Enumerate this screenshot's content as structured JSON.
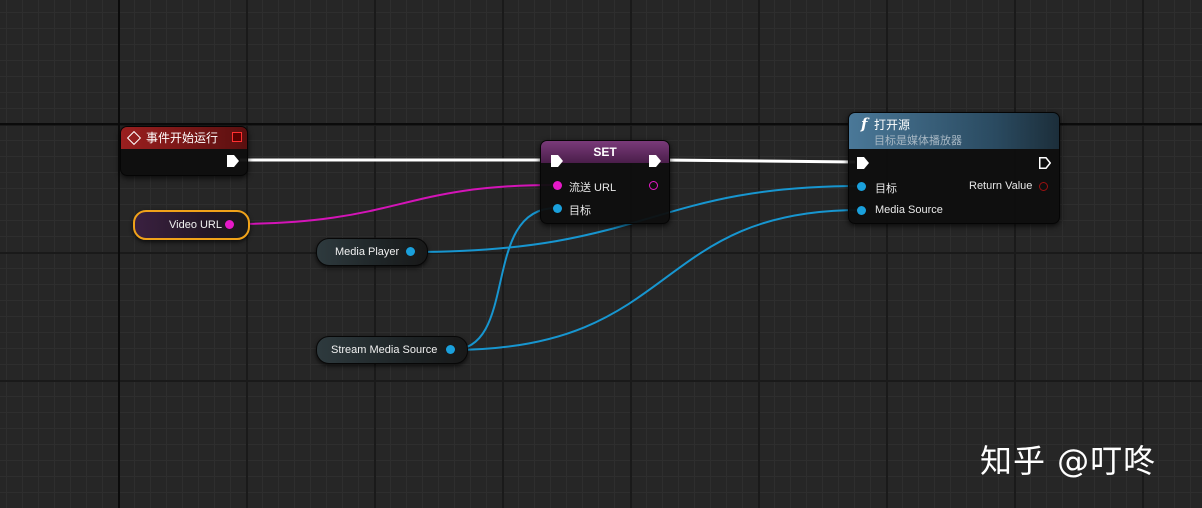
{
  "event_node": {
    "title": "事件开始运行"
  },
  "variables": {
    "video_url": "Video URL",
    "media_player": "Media Player",
    "stream_media_source": "Stream Media Source"
  },
  "set_node": {
    "title": "SET",
    "pin_stream_url": "流送 URL",
    "pin_target": "目标"
  },
  "open_source_node": {
    "icon": "f",
    "title": "打开源",
    "subtitle": "目标是媒体播放器",
    "pin_target": "目标",
    "pin_media_source": "Media Source",
    "pin_return_value": "Return Value"
  },
  "colors": {
    "event_header": "#8a1a1a",
    "set_header": "#6a2a6a",
    "function_header": "#3f6b8a",
    "string_pin": "#e619c8",
    "object_pin": "#1aa0dc",
    "exec_wire": "#ffffff",
    "bool_pin": "#8b0000"
  },
  "watermark": "知乎 @叮咚"
}
